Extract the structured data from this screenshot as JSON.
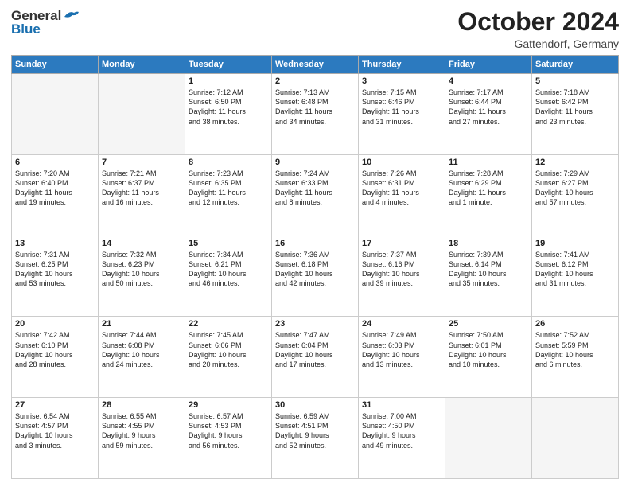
{
  "header": {
    "logo_line1": "General",
    "logo_line2": "Blue",
    "month": "October 2024",
    "location": "Gattendorf, Germany"
  },
  "days_of_week": [
    "Sunday",
    "Monday",
    "Tuesday",
    "Wednesday",
    "Thursday",
    "Friday",
    "Saturday"
  ],
  "weeks": [
    [
      {
        "day": "",
        "text": ""
      },
      {
        "day": "",
        "text": ""
      },
      {
        "day": "1",
        "text": "Sunrise: 7:12 AM\nSunset: 6:50 PM\nDaylight: 11 hours\nand 38 minutes."
      },
      {
        "day": "2",
        "text": "Sunrise: 7:13 AM\nSunset: 6:48 PM\nDaylight: 11 hours\nand 34 minutes."
      },
      {
        "day": "3",
        "text": "Sunrise: 7:15 AM\nSunset: 6:46 PM\nDaylight: 11 hours\nand 31 minutes."
      },
      {
        "day": "4",
        "text": "Sunrise: 7:17 AM\nSunset: 6:44 PM\nDaylight: 11 hours\nand 27 minutes."
      },
      {
        "day": "5",
        "text": "Sunrise: 7:18 AM\nSunset: 6:42 PM\nDaylight: 11 hours\nand 23 minutes."
      }
    ],
    [
      {
        "day": "6",
        "text": "Sunrise: 7:20 AM\nSunset: 6:40 PM\nDaylight: 11 hours\nand 19 minutes."
      },
      {
        "day": "7",
        "text": "Sunrise: 7:21 AM\nSunset: 6:37 PM\nDaylight: 11 hours\nand 16 minutes."
      },
      {
        "day": "8",
        "text": "Sunrise: 7:23 AM\nSunset: 6:35 PM\nDaylight: 11 hours\nand 12 minutes."
      },
      {
        "day": "9",
        "text": "Sunrise: 7:24 AM\nSunset: 6:33 PM\nDaylight: 11 hours\nand 8 minutes."
      },
      {
        "day": "10",
        "text": "Sunrise: 7:26 AM\nSunset: 6:31 PM\nDaylight: 11 hours\nand 4 minutes."
      },
      {
        "day": "11",
        "text": "Sunrise: 7:28 AM\nSunset: 6:29 PM\nDaylight: 11 hours\nand 1 minute."
      },
      {
        "day": "12",
        "text": "Sunrise: 7:29 AM\nSunset: 6:27 PM\nDaylight: 10 hours\nand 57 minutes."
      }
    ],
    [
      {
        "day": "13",
        "text": "Sunrise: 7:31 AM\nSunset: 6:25 PM\nDaylight: 10 hours\nand 53 minutes."
      },
      {
        "day": "14",
        "text": "Sunrise: 7:32 AM\nSunset: 6:23 PM\nDaylight: 10 hours\nand 50 minutes."
      },
      {
        "day": "15",
        "text": "Sunrise: 7:34 AM\nSunset: 6:21 PM\nDaylight: 10 hours\nand 46 minutes."
      },
      {
        "day": "16",
        "text": "Sunrise: 7:36 AM\nSunset: 6:18 PM\nDaylight: 10 hours\nand 42 minutes."
      },
      {
        "day": "17",
        "text": "Sunrise: 7:37 AM\nSunset: 6:16 PM\nDaylight: 10 hours\nand 39 minutes."
      },
      {
        "day": "18",
        "text": "Sunrise: 7:39 AM\nSunset: 6:14 PM\nDaylight: 10 hours\nand 35 minutes."
      },
      {
        "day": "19",
        "text": "Sunrise: 7:41 AM\nSunset: 6:12 PM\nDaylight: 10 hours\nand 31 minutes."
      }
    ],
    [
      {
        "day": "20",
        "text": "Sunrise: 7:42 AM\nSunset: 6:10 PM\nDaylight: 10 hours\nand 28 minutes."
      },
      {
        "day": "21",
        "text": "Sunrise: 7:44 AM\nSunset: 6:08 PM\nDaylight: 10 hours\nand 24 minutes."
      },
      {
        "day": "22",
        "text": "Sunrise: 7:45 AM\nSunset: 6:06 PM\nDaylight: 10 hours\nand 20 minutes."
      },
      {
        "day": "23",
        "text": "Sunrise: 7:47 AM\nSunset: 6:04 PM\nDaylight: 10 hours\nand 17 minutes."
      },
      {
        "day": "24",
        "text": "Sunrise: 7:49 AM\nSunset: 6:03 PM\nDaylight: 10 hours\nand 13 minutes."
      },
      {
        "day": "25",
        "text": "Sunrise: 7:50 AM\nSunset: 6:01 PM\nDaylight: 10 hours\nand 10 minutes."
      },
      {
        "day": "26",
        "text": "Sunrise: 7:52 AM\nSunset: 5:59 PM\nDaylight: 10 hours\nand 6 minutes."
      }
    ],
    [
      {
        "day": "27",
        "text": "Sunrise: 6:54 AM\nSunset: 4:57 PM\nDaylight: 10 hours\nand 3 minutes."
      },
      {
        "day": "28",
        "text": "Sunrise: 6:55 AM\nSunset: 4:55 PM\nDaylight: 9 hours\nand 59 minutes."
      },
      {
        "day": "29",
        "text": "Sunrise: 6:57 AM\nSunset: 4:53 PM\nDaylight: 9 hours\nand 56 minutes."
      },
      {
        "day": "30",
        "text": "Sunrise: 6:59 AM\nSunset: 4:51 PM\nDaylight: 9 hours\nand 52 minutes."
      },
      {
        "day": "31",
        "text": "Sunrise: 7:00 AM\nSunset: 4:50 PM\nDaylight: 9 hours\nand 49 minutes."
      },
      {
        "day": "",
        "text": ""
      },
      {
        "day": "",
        "text": ""
      }
    ]
  ]
}
